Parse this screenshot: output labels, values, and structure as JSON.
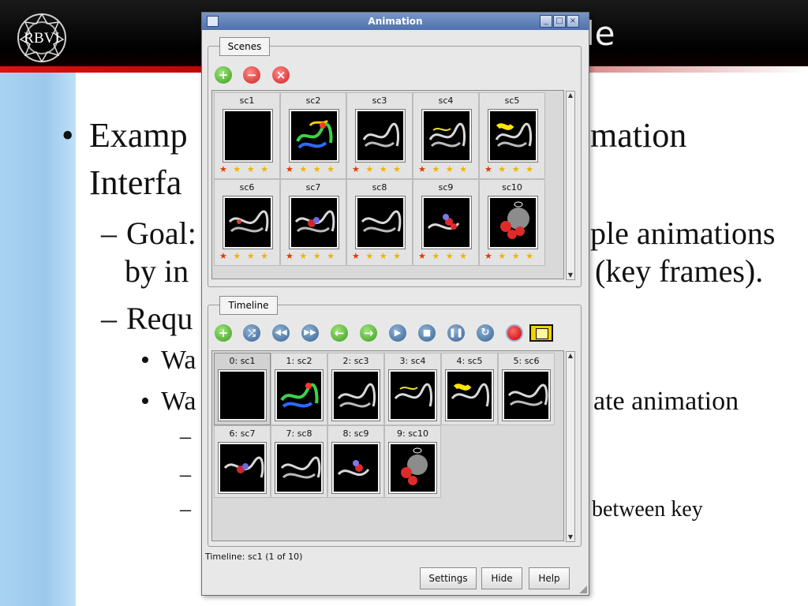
{
  "slide": {
    "logo_text": "RBVI",
    "title_fragment": "le",
    "bullets": {
      "b1a": "Examp",
      "b1a_right": "mation",
      "b1b": "Interfa",
      "b2a": "Goal:",
      "b2a_right": "ple animations",
      "b2b": "by in",
      "b2b_right": "(key frames).",
      "b3": "Requ",
      "b4a": "Wa",
      "b4b": "Wa",
      "b4b_right": "ate animation",
      "b5_right": "between key"
    }
  },
  "window": {
    "title": "Animation",
    "controls": [
      "_",
      "□",
      "×"
    ]
  },
  "scenes": {
    "tab_label": "Scenes",
    "toolbar": [
      "add-icon",
      "remove-icon",
      "delete-icon"
    ],
    "items": [
      {
        "label": "sc1"
      },
      {
        "label": "sc2"
      },
      {
        "label": "sc3"
      },
      {
        "label": "sc4"
      },
      {
        "label": "sc5"
      },
      {
        "label": "sc6"
      },
      {
        "label": "sc7"
      },
      {
        "label": "sc8"
      },
      {
        "label": "sc9"
      },
      {
        "label": "sc10"
      }
    ]
  },
  "timeline": {
    "tab_label": "Timeline",
    "toolbar": [
      "add-icon",
      "shuffle-icon",
      "rewind-icon",
      "fast-forward-icon",
      "step-back-icon",
      "step-forward-icon",
      "play-icon",
      "stop-icon",
      "pause-icon",
      "loop-icon",
      "record-icon",
      "film-icon"
    ],
    "items": [
      {
        "label": "0: sc1"
      },
      {
        "label": "1: sc2"
      },
      {
        "label": "2: sc3"
      },
      {
        "label": "3: sc4"
      },
      {
        "label": "4: sc5"
      },
      {
        "label": "5: sc6"
      },
      {
        "label": "6: sc7"
      },
      {
        "label": "7: sc8"
      },
      {
        "label": "8: sc9"
      },
      {
        "label": "9: sc10"
      }
    ]
  },
  "status": "Timeline: sc1 (1 of 10)",
  "buttons": {
    "settings": "Settings",
    "hide": "Hide",
    "help": "Help"
  },
  "colors": {
    "window_bg": "#e8e8e8",
    "titlebar": "#4f71ac",
    "star": "#f0b400"
  }
}
